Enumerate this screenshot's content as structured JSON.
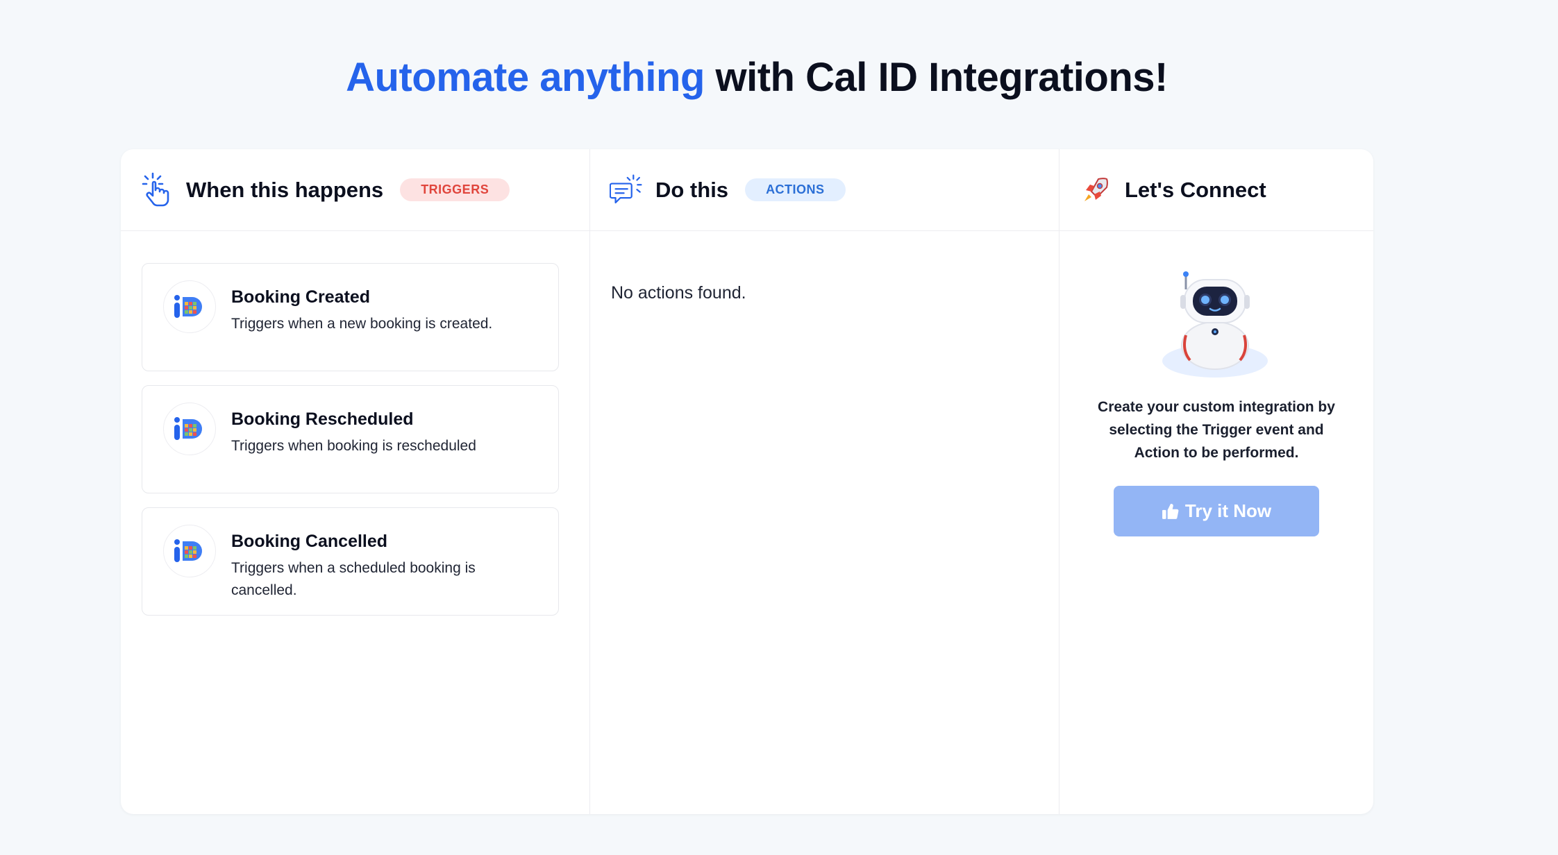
{
  "headline": {
    "accent": "Automate anything",
    "rest": "with Cal ID Integrations!"
  },
  "triggers_column": {
    "title": "When this happens",
    "badge": "TRIGGERS",
    "items": [
      {
        "title": "Booking Created",
        "description": "Triggers when a new booking is created."
      },
      {
        "title": "Booking Rescheduled",
        "description": "Triggers when booking is rescheduled"
      },
      {
        "title": "Booking Cancelled",
        "description": "Triggers when a scheduled booking is cancelled."
      }
    ]
  },
  "actions_column": {
    "title": "Do this",
    "badge": "ACTIONS",
    "empty_message": "No actions found."
  },
  "connect_column": {
    "title": "Let's Connect",
    "description": "Create your custom integration by selecting the Trigger event and Action to be performed.",
    "button_label": "Try it Now"
  },
  "colors": {
    "accent": "#2563eb",
    "trigger_badge": "#e0453c",
    "action_badge": "#2b6fd6",
    "button": "#93b5f5"
  },
  "icons": {
    "triggers": "tap-hand-icon",
    "actions": "chat-bubble-icon",
    "connect": "rocket-icon",
    "button": "thumbs-up-icon"
  }
}
